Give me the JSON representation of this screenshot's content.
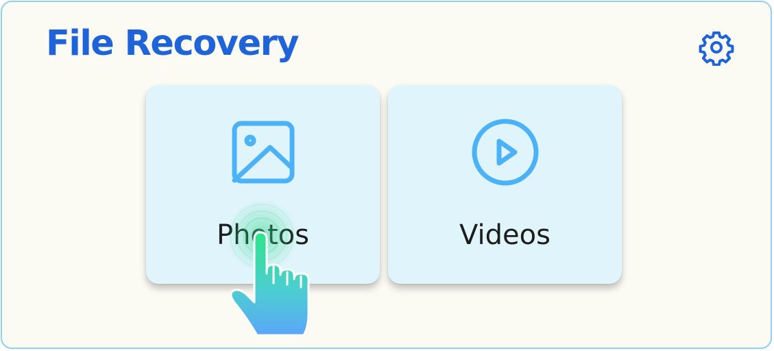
{
  "header": {
    "title": "File Recovery",
    "settings_icon": "gear-icon"
  },
  "options": [
    {
      "label": "Photos",
      "icon": "image-icon"
    },
    {
      "label": "Videos",
      "icon": "play-circle-icon"
    }
  ],
  "overlay": {
    "pointer_icon": "tapping-hand-icon"
  },
  "colors": {
    "title": "#1f63d9",
    "icon": "#4cb2f7",
    "card_background": "#dff4fb",
    "panel_background": "#fbfaf3",
    "panel_border": "#8fd0f2"
  }
}
